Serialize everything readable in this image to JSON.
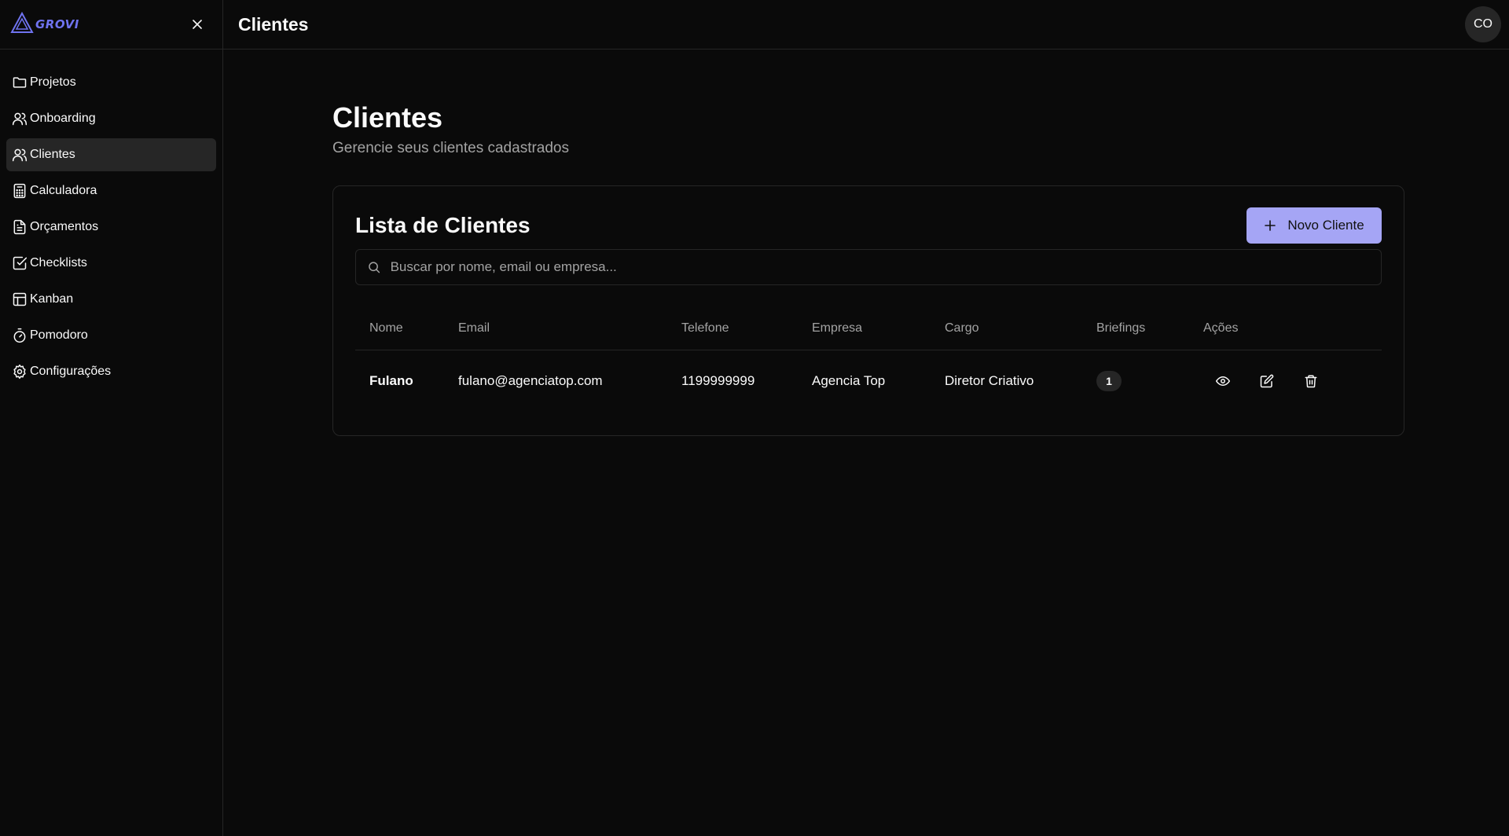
{
  "app": {
    "logo_text": "GROVI",
    "accent_color": "#6f73f0",
    "button_color": "#a5a5f5"
  },
  "sidebar": {
    "items": [
      {
        "label": "Projetos",
        "icon": "folder-icon"
      },
      {
        "label": "Onboarding",
        "icon": "users-icon"
      },
      {
        "label": "Clientes",
        "icon": "users-icon",
        "active": true
      },
      {
        "label": "Calculadora",
        "icon": "calculator-icon"
      },
      {
        "label": "Orçamentos",
        "icon": "file-text-icon"
      },
      {
        "label": "Checklists",
        "icon": "check-square-icon"
      },
      {
        "label": "Kanban",
        "icon": "kanban-icon"
      },
      {
        "label": "Pomodoro",
        "icon": "timer-icon"
      },
      {
        "label": "Configurações",
        "icon": "gear-icon"
      }
    ]
  },
  "header": {
    "title": "Clientes",
    "avatar_initials": "CO"
  },
  "page": {
    "title": "Clientes",
    "subtitle": "Gerencie seus clientes cadastrados"
  },
  "card": {
    "title": "Lista de Clientes",
    "new_button_label": "Novo Cliente",
    "search_placeholder": "Buscar por nome, email ou empresa..."
  },
  "table": {
    "columns": [
      "Nome",
      "Email",
      "Telefone",
      "Empresa",
      "Cargo",
      "Briefings",
      "Ações"
    ],
    "rows": [
      {
        "nome": "Fulano",
        "email": "fulano@agenciatop.com",
        "telefone": "1199999999",
        "empresa": "Agencia Top",
        "cargo": "Diretor Criativo",
        "briefings": "1"
      }
    ]
  }
}
